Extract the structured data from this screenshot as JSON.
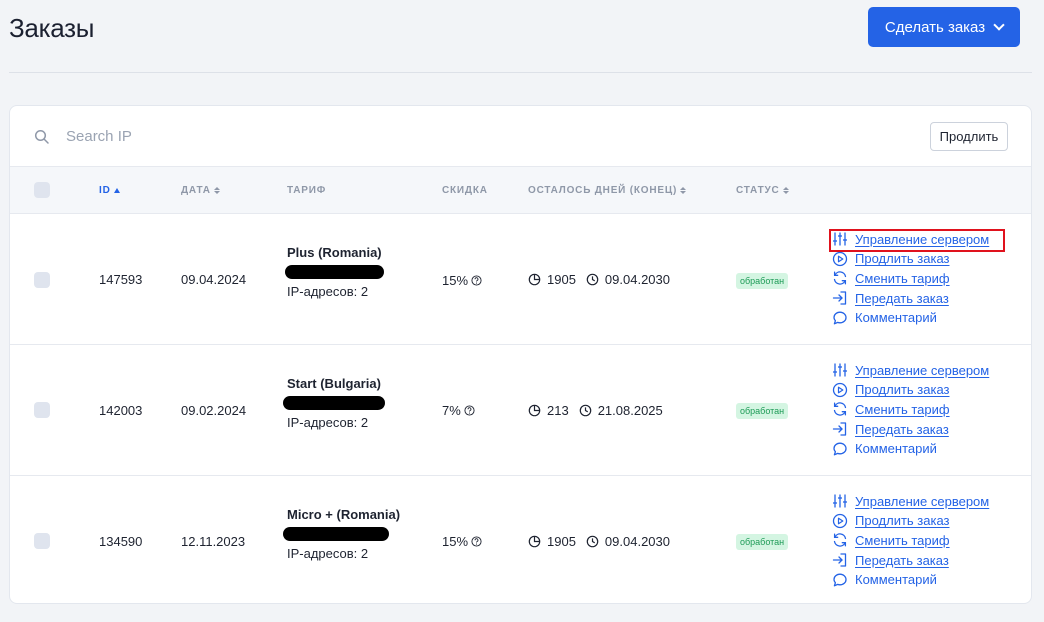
{
  "page": {
    "title": "Заказы"
  },
  "header": {
    "order_button": "Сделать заказ"
  },
  "toolbar": {
    "search_placeholder": "Search IP",
    "extend_button": "Продлить"
  },
  "table": {
    "headers": {
      "id": "ID",
      "date": "ДАТА",
      "tariff": "ТАРИФ",
      "discount": "СКИДКА",
      "days_left": "ОСТАЛОСЬ ДНЕЙ (КОНЕЦ)",
      "status": "СТАТУС"
    },
    "actions": {
      "manage": "Управление сервером",
      "extend": "Продлить заказ",
      "change": "Сменить тариф",
      "transfer": "Передать заказ",
      "comment": "Комментарий"
    },
    "rows": [
      {
        "id": "147593",
        "date": "09.04.2024",
        "tariff": "Plus (Romania)",
        "ips": "IP-адресов: 2",
        "discount": "15%",
        "days": "1905",
        "end": "09.04.2030",
        "status": "обработан"
      },
      {
        "id": "142003",
        "date": "09.02.2024",
        "tariff": "Start (Bulgaria)",
        "ips": "IP-адресов: 2",
        "discount": "7%",
        "days": "213",
        "end": "21.08.2025",
        "status": "обработан"
      },
      {
        "id": "134590",
        "date": "12.11.2023",
        "tariff": "Micro + (Romania)",
        "ips": "IP-адресов: 2",
        "discount": "15%",
        "days": "1905",
        "end": "09.04.2030",
        "status": "обработан"
      }
    ]
  },
  "colors": {
    "accent": "#2463e6",
    "status_bg": "#d4f5e2",
    "status_text": "#1e9b57",
    "highlight": "#e0121d"
  }
}
